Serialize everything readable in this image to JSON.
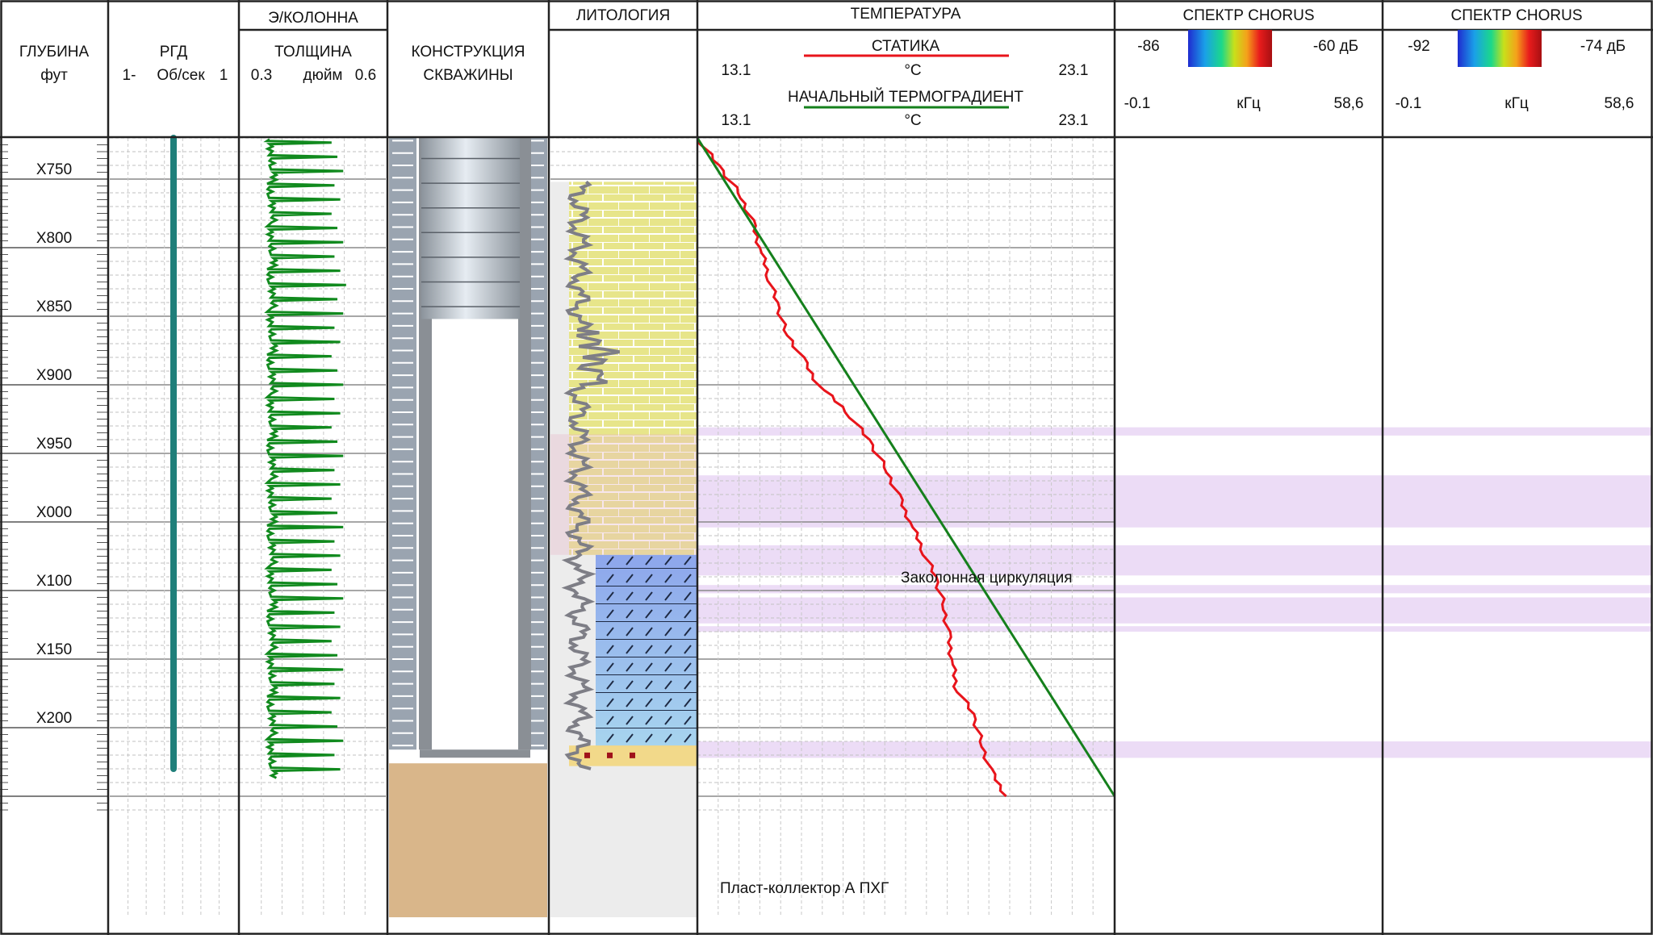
{
  "header": {
    "depth_title": "ГЛУБИНА",
    "depth_unit": "фут",
    "rgd_title": "РГД",
    "rgd_min": "1-",
    "rgd_unit": "Об/сек",
    "rgd_max": "1",
    "em_group": "Э/КОЛОННА",
    "em_title": "ТОЛЩИНА",
    "em_min": "0.3",
    "em_unit": "дюйм",
    "em_max": "0.6",
    "construction_line1": "КОНСТРУКЦИЯ",
    "construction_line2": "СКВАЖИНЫ",
    "lithology_title": "ЛИТОЛОГИЯ",
    "temp_group": "ТЕМПЕРАТУРА",
    "temp_static_title": "СТАТИКА",
    "temp_static_min": "13.1",
    "temp_static_unit": "°C",
    "temp_static_max": "23.1",
    "temp_grad_title": "НАЧАЛЬНЫЙ ТЕРМОГРАДИЕНТ",
    "temp_grad_min": "13.1",
    "temp_grad_unit": "°C",
    "temp_grad_max": "23.1",
    "chorus1_title": "СПЕКТР CHORUS",
    "chorus1_db_min": "-86",
    "chorus1_db_max": "-60 дБ",
    "chorus1_f_min": "-0.1",
    "chorus1_f_unit": "кГц",
    "chorus1_f_max": "58,6",
    "chorus2_title": "СПЕКТР CHORUS",
    "chorus2_db_min": "-92",
    "chorus2_db_max": "-74 дБ",
    "chorus2_f_min": "-0.1",
    "chorus2_f_unit": "кГц",
    "chorus2_f_max": "58,6"
  },
  "annotations": {
    "circulation": "Заколонная циркуляция",
    "reservoir": "Пласт-коллектор А ПХГ"
  },
  "colors": {
    "static": "#e8141b",
    "gradient": "#15801c",
    "em_curve": "#118a1e",
    "rgd": "#1f7f7a",
    "flow_zone": "#ecdcf6",
    "limestone": "#e7e58a",
    "dolomite": "#9bb4ee",
    "reservoir": "#f2d98a",
    "grid": "#9a9a9a",
    "frame": "#222222"
  },
  "chart_data": {
    "type": "well_log",
    "depth_axis": {
      "unit": "фут",
      "range": [
        "X720",
        "X210"
      ],
      "tick_labels": [
        "X750",
        "X800",
        "X850",
        "X900",
        "X950",
        "X000",
        "X100",
        "X150",
        "X200"
      ]
    },
    "tracks": {
      "rgd": {
        "label": "РГД",
        "range": [
          -1,
          1
        ],
        "unit": "Об/сек",
        "value": 0
      },
      "em_thickness": {
        "label": "ТОЛЩИНА",
        "range": [
          0.3,
          0.6
        ],
        "unit": "дюйм",
        "baseline": 0.36,
        "spike_count": 44,
        "spike_peak_approx": 0.5
      },
      "temperature": {
        "range": [
          13.1,
          23.1
        ],
        "unit": "°C",
        "series": [
          {
            "name": "СТАТИКА",
            "depth": [
              720,
              740,
              760,
              780,
              800,
              820,
              840,
              860,
              880,
              900,
              920,
              940,
              960,
              980,
              1000,
              1020,
              1040,
              1060,
              1080,
              1100,
              1120,
              1140,
              1160,
              1180,
              1200
            ],
            "temperature": [
              13.1,
              13.6,
              14.1,
              14.4,
              14.6,
              14.8,
              15.0,
              15.2,
              15.6,
              16.0,
              16.7,
              17.2,
              17.6,
              17.9,
              18.2,
              18.5,
              18.8,
              19.0,
              19.1,
              19.2,
              19.3,
              19.7,
              19.9,
              20.1,
              20.5
            ]
          },
          {
            "name": "НАЧАЛЬНЫЙ ТЕРМОГРАДИЕНТ",
            "depth": [
              720,
              1200
            ],
            "temperature": [
              13.1,
              23.1
            ]
          }
        ]
      },
      "chorus_1": {
        "db_range": [
          -86,
          -60
        ],
        "freq_range_khz": [
          -0.1,
          58.6
        ]
      },
      "chorus_2": {
        "db_range": [
          -92,
          -74
        ],
        "freq_range_khz": [
          -0.1,
          58.6
        ]
      }
    },
    "noise_zones": [
      {
        "top": 931,
        "bottom": 937
      },
      {
        "top": 966,
        "bottom": 1004
      },
      {
        "top": 1017,
        "bottom": 1039
      },
      {
        "top": 1046,
        "bottom": 1052
      },
      {
        "top": 1055,
        "bottom": 1074
      },
      {
        "top": 1076,
        "bottom": 1080
      },
      {
        "top": 1160,
        "bottom": 1172
      }
    ],
    "lithology": [
      {
        "top": 752,
        "bottom": 1024,
        "rock": "limestone"
      },
      {
        "top": 1024,
        "bottom": 1163,
        "rock": "dolomite"
      },
      {
        "top": 1163,
        "bottom": 1178,
        "rock": "reservoir"
      }
    ]
  }
}
